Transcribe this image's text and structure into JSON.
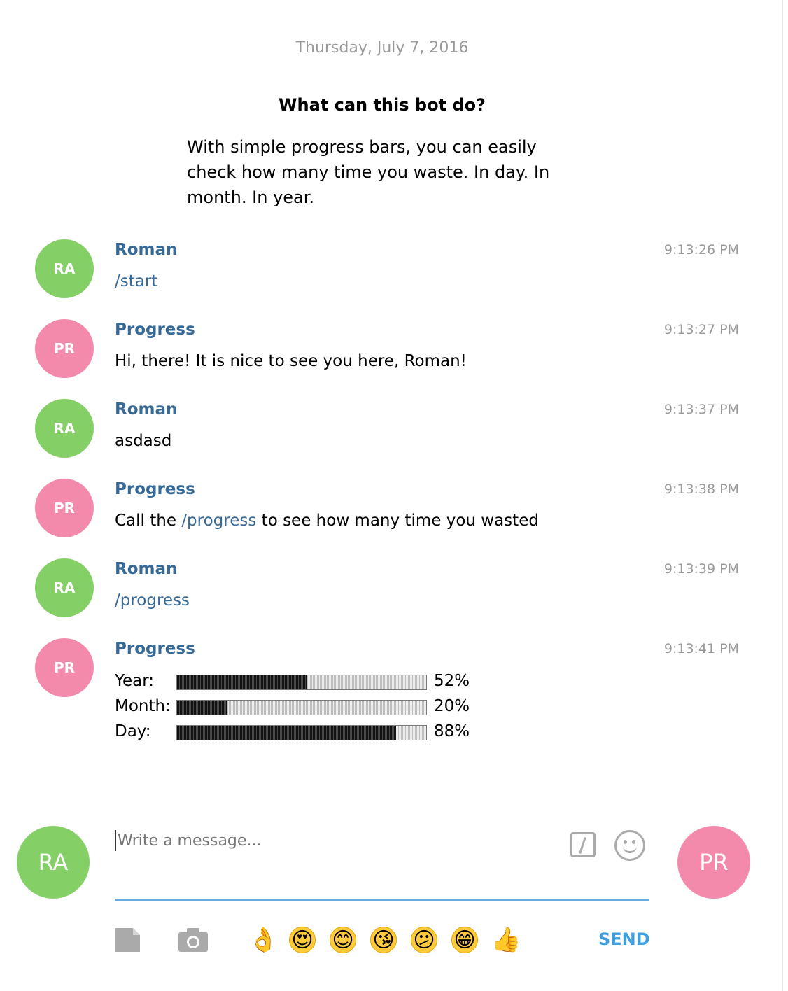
{
  "date_header": "Thursday, July 7, 2016",
  "intro": {
    "title": "What can this bot do?",
    "body": "With simple progress bars, you can easily check how many time you waste. In day. In month. In year."
  },
  "colors": {
    "user_avatar": "#84d066",
    "bot_avatar": "#f38aac",
    "sender_name": "#386a98",
    "accent": "#3d9ee0"
  },
  "messages": [
    {
      "avatar": "RA",
      "sender": "Roman",
      "time": "9:13:26 PM",
      "text": "/start"
    },
    {
      "avatar": "PR",
      "sender": "Progress",
      "time": "9:13:27 PM",
      "text": "Hi, there! It is nice to see you here, Roman!"
    },
    {
      "avatar": "RA",
      "sender": "Roman",
      "time": "9:13:37 PM",
      "text": "asdasd"
    },
    {
      "avatar": "PR",
      "sender": "Progress",
      "time": "9:13:38 PM",
      "text_before": "Call the ",
      "command": "/progress",
      "text_after": " to see how many time you wasted"
    },
    {
      "avatar": "RA",
      "sender": "Roman",
      "time": "9:13:39 PM",
      "text": "/progress"
    },
    {
      "avatar": "PR",
      "sender": "Progress",
      "time": "9:13:41 PM",
      "progress": [
        {
          "label": "Year:",
          "value": 0.52,
          "pct": "52%"
        },
        {
          "label": "Month:",
          "value": 0.2,
          "pct": "20%"
        },
        {
          "label": "Day:",
          "value": 0.88,
          "pct": "88%"
        }
      ]
    }
  ],
  "composer": {
    "self_avatar": "RA",
    "peer_avatar": "PR",
    "placeholder": "Write a message...",
    "send_label": "SEND",
    "icons": [
      "attach-file-icon",
      "camera-icon",
      "command-icon",
      "emoji-picker-icon"
    ],
    "emojis": [
      "👌",
      "😍",
      "😊",
      "😘",
      "😕",
      "😁",
      "👍"
    ]
  }
}
